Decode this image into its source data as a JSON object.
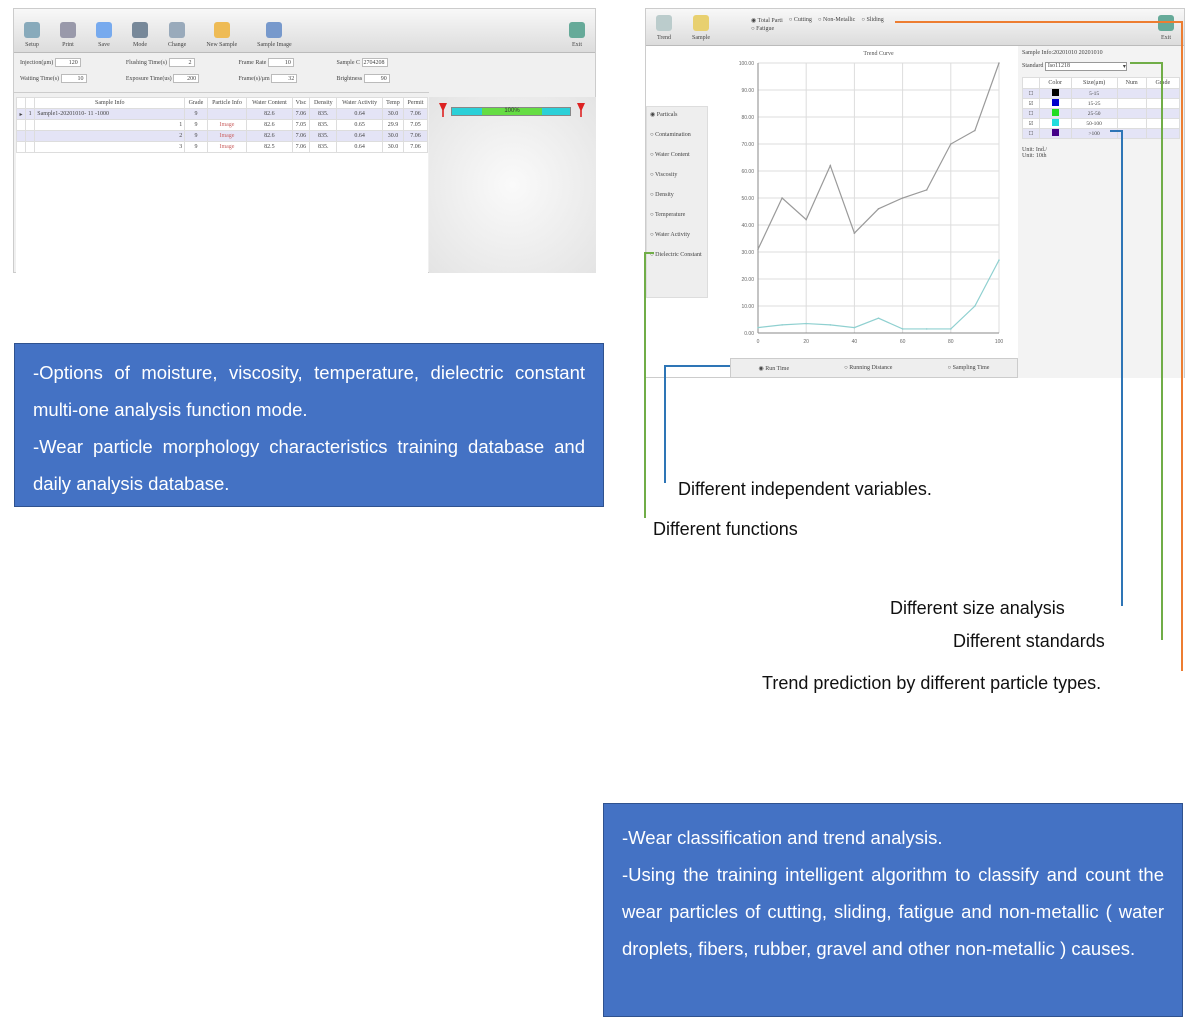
{
  "left_app": {
    "toolbar": [
      {
        "label": "Setup",
        "icon": "settings-icon"
      },
      {
        "label": "Print",
        "icon": "printer-icon"
      },
      {
        "label": "Save",
        "icon": "save-icon"
      },
      {
        "label": "Mode",
        "icon": "mode-icon"
      },
      {
        "label": "Change",
        "icon": "change-icon"
      },
      {
        "label": "New Sample",
        "icon": "new-sample-icon"
      },
      {
        "label": "Sample Image",
        "icon": "sample-image-icon"
      },
      {
        "label": "Exit",
        "icon": "exit-icon"
      }
    ],
    "params": [
      {
        "label": "Injection(μm)",
        "value": "120"
      },
      {
        "label": "Flushing Time(s)",
        "value": "2"
      },
      {
        "label": "Frame Rate",
        "value": "10"
      },
      {
        "label": "Sample C",
        "value": "2704208"
      },
      {
        "label": "Waiting Time(s)",
        "value": "10"
      },
      {
        "label": "Exposure Time(us)",
        "value": "200"
      },
      {
        "label": "Frame(s)/μm",
        "value": "32"
      },
      {
        "label": "Brightness",
        "value": "90"
      }
    ],
    "table": {
      "headers": [
        "",
        "",
        "Sample Info",
        "Grade",
        "Particle Info",
        "Water Content",
        "Visc",
        "Density",
        "Water Activity",
        "Temp",
        "Permit"
      ],
      "rows": [
        [
          "▸",
          "1",
          "Sample1-20201010- 11  -1000",
          "9",
          "",
          "82.6",
          "7.06",
          "835.",
          "0.64",
          "30.0",
          "7.06"
        ],
        [
          "",
          "",
          "1",
          "9",
          "Image",
          "82.6",
          "7.05",
          "835.",
          "0.65",
          "29.9",
          "7.05"
        ],
        [
          "",
          "",
          "2",
          "9",
          "Image",
          "82.6",
          "7.06",
          "835.",
          "0.64",
          "30.0",
          "7.06"
        ],
        [
          "",
          "",
          "3",
          "9",
          "Image",
          "82.5",
          "7.06",
          "835.",
          "0.64",
          "30.0",
          "7.06"
        ]
      ]
    },
    "progress": {
      "label": "100%",
      "value": 100
    }
  },
  "right_app": {
    "toolbar": {
      "trend": "Trend",
      "sample": "Sample",
      "exit": "Exit"
    },
    "particle_types": [
      {
        "label": "Total Parti",
        "checked": true
      },
      {
        "label": "Cutting",
        "checked": false
      },
      {
        "label": "Non-Metallic",
        "checked": false
      },
      {
        "label": "Sliding",
        "checked": false
      },
      {
        "label": "Fatigue",
        "checked": false
      }
    ],
    "functions": [
      {
        "label": "Particals",
        "checked": true
      },
      {
        "label": "Contamination",
        "checked": false
      },
      {
        "label": "Water Content",
        "checked": false
      },
      {
        "label": "Viscosity",
        "checked": false
      },
      {
        "label": "Density",
        "checked": false
      },
      {
        "label": "Temperature",
        "checked": false
      },
      {
        "label": "Water Activity",
        "checked": false
      },
      {
        "label": "Dielectric Constant",
        "checked": false
      }
    ],
    "x_variables": [
      {
        "label": "Run Time",
        "checked": true
      },
      {
        "label": "Running Distance",
        "checked": false
      },
      {
        "label": "Sampling Time",
        "checked": false
      }
    ],
    "sample_info": "Sample Info:20201010   20201010",
    "standard_label": "Standard",
    "standard_value": "Iso11218",
    "size_table": {
      "headers": [
        "",
        "Color",
        "Size(μm)",
        "Num",
        "Grade"
      ],
      "rows": [
        {
          "checked": false,
          "color": "#000000",
          "size": "5-15"
        },
        {
          "checked": true,
          "color": "#0000cc",
          "size": "15-25"
        },
        {
          "checked": false,
          "color": "#22dd22",
          "size": "25-50"
        },
        {
          "checked": true,
          "color": "#22dddd",
          "size": "50-100"
        },
        {
          "checked": false,
          "color": "#440088",
          "size": ">100"
        }
      ]
    },
    "units": [
      "Unit: Ind./",
      "Unit: 10th"
    ]
  },
  "chart_data": {
    "type": "line",
    "title": "Trend Curve",
    "x": [
      0,
      10,
      20,
      30,
      40,
      50,
      60,
      70,
      80,
      90,
      100
    ],
    "series": [
      {
        "color": "#9a9a9a",
        "values": [
          31,
          50,
          42,
          62,
          37,
          46,
          50,
          53,
          70,
          75,
          100
        ]
      },
      {
        "color": "#8fd0d0",
        "values": [
          2,
          3,
          3.5,
          3,
          2,
          5.5,
          1.5,
          1.5,
          1.5,
          10,
          27
        ]
      }
    ],
    "xticks": [
      "0",
      "20",
      "40",
      "60",
      "80",
      "100"
    ],
    "yticks": [
      "0.00",
      "10.00",
      "20.00",
      "30.00",
      "40.00",
      "50.00",
      "60.00",
      "70.00",
      "80.00",
      "90.00",
      "100.00"
    ],
    "xlim": [
      0,
      100
    ],
    "ylim": [
      0,
      100
    ],
    "grid": true
  },
  "annotations": {
    "box1": [
      "-Options of moisture, viscosity, temperature, dielectric constant multi-one analysis function mode.",
      "-Wear particle morphology characteristics training database and daily analysis database."
    ],
    "box2": [
      "-Wear classification and trend analysis.",
      "-Using the training intelligent algorithm to classify and count the wear particles of cutting, sliding, fatigue and non-metallic ( water droplets, fibers, rubber, gravel and other non-metallic ) causes."
    ],
    "independent": "Different independent variables.",
    "functions": "Different functions",
    "size": "Different size analysis",
    "standards": "Different standards",
    "trend": "Trend prediction by different particle types.",
    "colors": {
      "box": "#4472c4",
      "orange": "#ed7d31",
      "green": "#70ad47",
      "blue": "#2e75b6"
    }
  }
}
